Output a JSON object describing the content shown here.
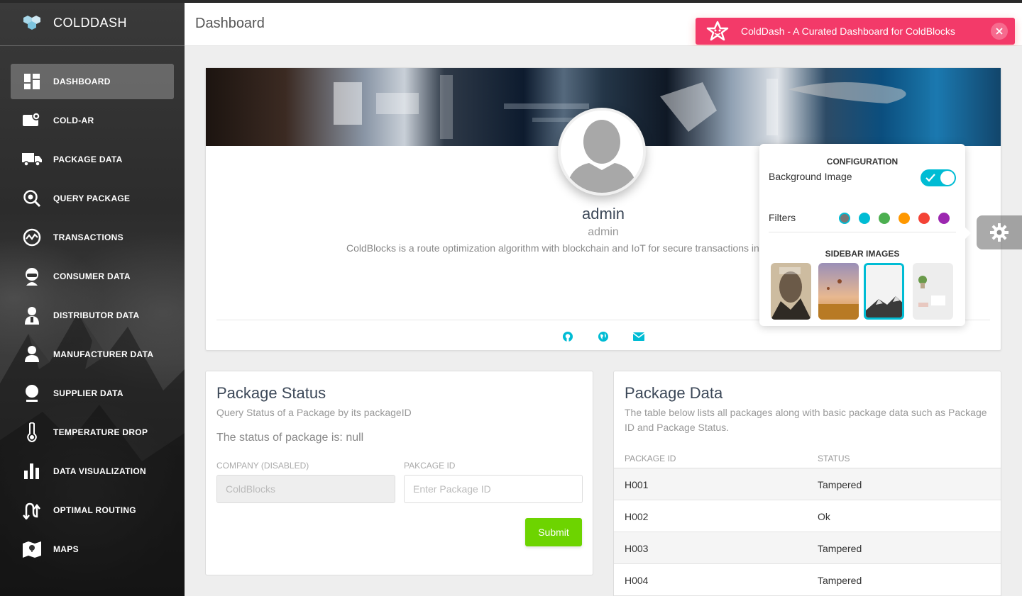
{
  "app": {
    "name": "COLDDASH"
  },
  "header": {
    "title": "Dashboard"
  },
  "notification": {
    "text": "ColdDash - A Curated Dashboard for ColdBlocks",
    "color": "#f33a69"
  },
  "sidebar": {
    "items": [
      {
        "label": "DASHBOARD",
        "icon": "dashboard-icon",
        "active": true
      },
      {
        "label": "COLD-AR",
        "icon": "ar-camera-icon"
      },
      {
        "label": "PACKAGE DATA",
        "icon": "truck-icon"
      },
      {
        "label": "QUERY PACKAGE",
        "icon": "query-search-icon"
      },
      {
        "label": "TRANSACTIONS",
        "icon": "transactions-icon"
      },
      {
        "label": "CONSUMER DATA",
        "icon": "consumer-icon"
      },
      {
        "label": "DISTRIBUTOR DATA",
        "icon": "distributor-icon"
      },
      {
        "label": "MANUFACTURER DATA",
        "icon": "manufacturer-icon"
      },
      {
        "label": "SUPPLIER DATA",
        "icon": "supplier-icon"
      },
      {
        "label": "TEMPERATURE DROP",
        "icon": "thermometer-icon"
      },
      {
        "label": "DATA VISUALIZATION",
        "icon": "bar-chart-icon"
      },
      {
        "label": "OPTIMAL ROUTING",
        "icon": "route-icon"
      },
      {
        "label": "MAPS",
        "icon": "map-icon"
      }
    ]
  },
  "profile": {
    "name": "admin",
    "role": "admin",
    "description": "ColdBlocks is a route optimization algorithm with blockchain and IoT for secure transactions in"
  },
  "config": {
    "title": "CONFIGURATION",
    "background_label": "Background Image",
    "background_on": true,
    "filters_label": "Filters",
    "filters": [
      "#777777",
      "#00bcd4",
      "#4caf50",
      "#ff9800",
      "#f44336",
      "#9c27b0"
    ],
    "sidebar_images_label": "SIDEBAR IMAGES"
  },
  "package_status": {
    "title": "Package Status",
    "subtitle": "Query Status of a Package by its packageID",
    "status_text": "The status of package is: null",
    "company_label": "COMPANY (DISABLED)",
    "company_value": "ColdBlocks",
    "package_id_label": "PAKCAGE ID",
    "package_id_placeholder": "Enter Package ID",
    "submit_label": "Submit"
  },
  "package_data": {
    "title": "Package Data",
    "subtitle": "The table below lists all packages along with basic package data such as Package ID and Package Status.",
    "columns": [
      "PACKAGE ID",
      "STATUS"
    ],
    "rows": [
      {
        "id": "H001",
        "status": "Tampered"
      },
      {
        "id": "H002",
        "status": "Ok"
      },
      {
        "id": "H003",
        "status": "Tampered"
      },
      {
        "id": "H004",
        "status": "Tampered"
      }
    ]
  }
}
